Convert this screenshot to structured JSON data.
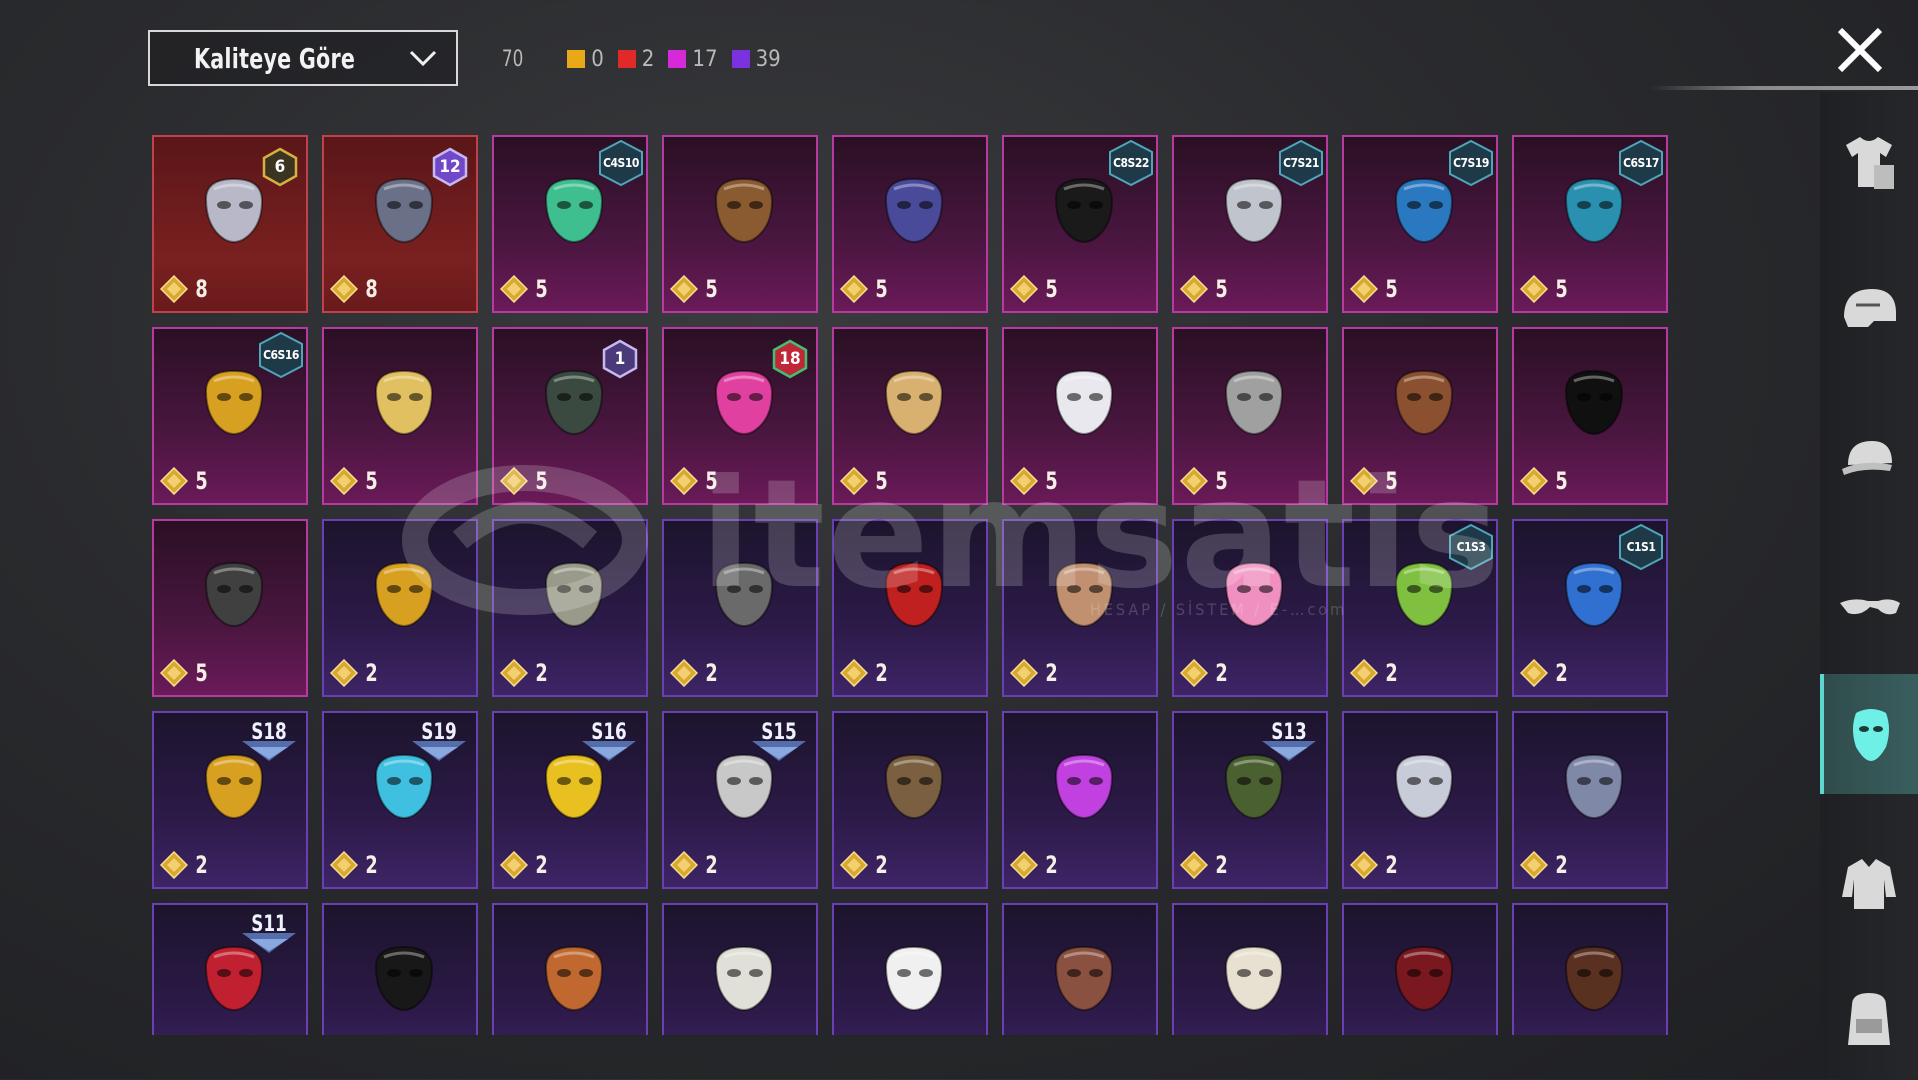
{
  "header": {
    "sort_label": "Kaliteye Göre",
    "total": "70",
    "counts": [
      {
        "color": "#e8a818",
        "value": "0"
      },
      {
        "color": "#e02a2a",
        "value": "2"
      },
      {
        "color": "#d62ad8",
        "value": "17"
      },
      {
        "color": "#7a32e0",
        "value": "39"
      }
    ]
  },
  "watermark": {
    "text": "itemsatis",
    "subtext": "HESAP / SİSTEM / E-…com"
  },
  "sidebar": [
    {
      "icon": "outfit-icon",
      "active": false
    },
    {
      "icon": "helmet-icon",
      "active": false
    },
    {
      "icon": "cap-icon",
      "active": false
    },
    {
      "icon": "glasses-icon",
      "active": false
    },
    {
      "icon": "face-mask-icon",
      "active": true
    },
    {
      "icon": "jacket-icon",
      "active": false
    },
    {
      "icon": "backpack-icon",
      "active": false
    }
  ],
  "items": [
    {
      "rarity": "red",
      "price": "8",
      "badge": "6",
      "badgeType": "num",
      "item": "plague-doctor-mask"
    },
    {
      "rarity": "red",
      "price": "8",
      "badge": "12",
      "badgeType": "num",
      "item": "knight-helmet-mask"
    },
    {
      "rarity": "pink",
      "price": "5",
      "badge": "C4S10",
      "badgeType": "hex",
      "item": "green-cloth-mask"
    },
    {
      "rarity": "pink",
      "price": "5",
      "badge": "",
      "badgeType": "",
      "item": "leather-bandana"
    },
    {
      "rarity": "pink",
      "price": "5",
      "badge": "",
      "badgeType": "",
      "item": "tactical-visor"
    },
    {
      "rarity": "pink",
      "price": "5",
      "badge": "C8S22",
      "badgeType": "hex",
      "item": "black-ring-mask"
    },
    {
      "rarity": "pink",
      "price": "5",
      "badge": "C7S21",
      "badgeType": "hex",
      "item": "silver-mech-mask"
    },
    {
      "rarity": "pink",
      "price": "5",
      "badge": "C7S19",
      "badgeType": "hex",
      "item": "graffiti-mask"
    },
    {
      "rarity": "pink",
      "price": "5",
      "badge": "C6S17",
      "badgeType": "hex",
      "item": "neon-cloth-mask"
    },
    {
      "rarity": "pink",
      "price": "5",
      "badge": "C6S16",
      "badgeType": "hex",
      "item": "yellow-respirator"
    },
    {
      "rarity": "pink",
      "price": "5",
      "badge": "",
      "badgeType": "",
      "item": "golden-crown-mask"
    },
    {
      "rarity": "pink",
      "price": "5",
      "badge": "1",
      "badgeType": "num",
      "item": "dark-skull-helmet"
    },
    {
      "rarity": "pink",
      "price": "5",
      "badge": "18",
      "badgeType": "num",
      "item": "pink-heart-mask"
    },
    {
      "rarity": "pink",
      "price": "5",
      "badge": "",
      "badgeType": "",
      "item": "laurel-gold-mask"
    },
    {
      "rarity": "pink",
      "price": "5",
      "badge": "",
      "badgeType": "",
      "item": "red-white-mask"
    },
    {
      "rarity": "pink",
      "price": "5",
      "badge": "",
      "badgeType": "",
      "item": "gas-mask"
    },
    {
      "rarity": "pink",
      "price": "5",
      "badge": "",
      "badgeType": "",
      "item": "bird-beak-mask"
    },
    {
      "rarity": "pink",
      "price": "5",
      "badge": "",
      "badgeType": "",
      "item": "black-balaclava"
    },
    {
      "rarity": "pink",
      "price": "5",
      "badge": "",
      "badgeType": "",
      "item": "skull-scarf"
    },
    {
      "rarity": "purple",
      "price": "2",
      "badge": "",
      "badgeType": "",
      "item": "gold-masquerade"
    },
    {
      "rarity": "purple",
      "price": "2",
      "badge": "",
      "badgeType": "",
      "item": "hockey-mask"
    },
    {
      "rarity": "purple",
      "price": "2",
      "badge": "",
      "badgeType": "",
      "item": "metal-jaw-mask"
    },
    {
      "rarity": "purple",
      "price": "2",
      "badge": "",
      "badgeType": "",
      "item": "red-eye-visor"
    },
    {
      "rarity": "purple",
      "price": "2",
      "badge": "",
      "badgeType": "",
      "item": "mammoth-mask"
    },
    {
      "rarity": "purple",
      "price": "2",
      "badge": "",
      "badgeType": "",
      "item": "pink-dino-mask"
    },
    {
      "rarity": "purple",
      "price": "2",
      "badge": "C1S3",
      "badgeType": "hex",
      "item": "cactus-bandana"
    },
    {
      "rarity": "purple",
      "price": "2",
      "badge": "C1S1",
      "badgeType": "hex",
      "item": "blue-wave-mask"
    },
    {
      "rarity": "purple",
      "price": "2",
      "badge": "S18",
      "badgeType": "season",
      "item": "gold-line-mask"
    },
    {
      "rarity": "purple",
      "price": "2",
      "badge": "S19",
      "badgeType": "season",
      "item": "cyan-visor"
    },
    {
      "rarity": "purple",
      "price": "2",
      "badge": "S16",
      "badgeType": "season",
      "item": "yellow-tech-mask"
    },
    {
      "rarity": "purple",
      "price": "2",
      "badge": "S15",
      "badgeType": "season",
      "item": "horned-skull-mask"
    },
    {
      "rarity": "purple",
      "price": "2",
      "badge": "",
      "badgeType": "",
      "item": "bronze-visor"
    },
    {
      "rarity": "purple",
      "price": "2",
      "badge": "",
      "badgeType": "",
      "item": "purple-gas-mask"
    },
    {
      "rarity": "purple",
      "price": "2",
      "badge": "S13",
      "badgeType": "season",
      "item": "goggle-helmet"
    },
    {
      "rarity": "purple",
      "price": "2",
      "badge": "",
      "badgeType": "",
      "item": "steel-helmet-mask"
    },
    {
      "rarity": "purple",
      "price": "2",
      "badge": "",
      "badgeType": "",
      "item": "chrome-mask"
    },
    {
      "rarity": "purple",
      "price": "",
      "badge": "S11",
      "badgeType": "season",
      "item": "red-half-mask"
    },
    {
      "rarity": "purple",
      "price": "",
      "badge": "",
      "badgeType": "",
      "item": "ninja-hood"
    },
    {
      "rarity": "purple",
      "price": "",
      "badge": "",
      "badgeType": "",
      "item": "plaid-wrap"
    },
    {
      "rarity": "purple",
      "price": "",
      "badge": "",
      "badgeType": "",
      "item": "bandage-mask"
    },
    {
      "rarity": "purple",
      "price": "",
      "badge": "",
      "badgeType": "",
      "item": "clown-mask"
    },
    {
      "rarity": "purple",
      "price": "",
      "badge": "",
      "badgeType": "",
      "item": "monster-jaw"
    },
    {
      "rarity": "purple",
      "price": "",
      "badge": "",
      "badgeType": "",
      "item": "white-scarf"
    },
    {
      "rarity": "purple",
      "price": "",
      "badge": "",
      "badgeType": "",
      "item": "red-dark-mask"
    },
    {
      "rarity": "purple",
      "price": "",
      "badge": "",
      "badgeType": "",
      "item": "brown-beard"
    }
  ]
}
